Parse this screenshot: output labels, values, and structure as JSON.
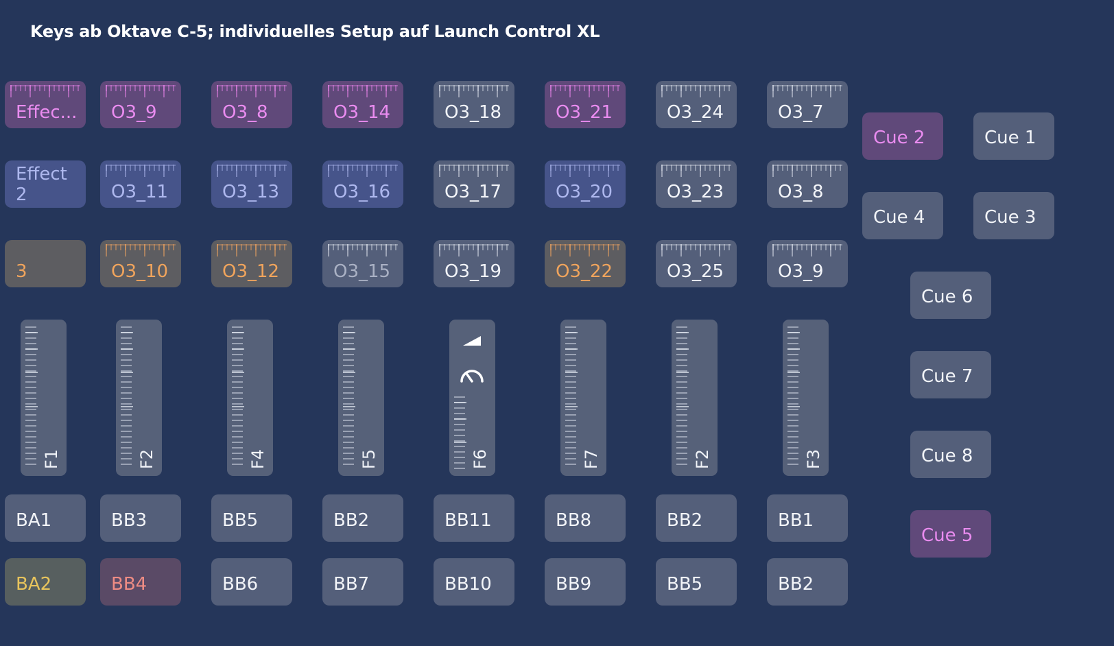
{
  "title": "Keys ab Oktave C-5; individuelles Setup auf Launch Control XL",
  "rows": {
    "row1": [
      "Effec...",
      "O3_9",
      "O3_8",
      "O3_14",
      "O3_18",
      "O3_21",
      "O3_24",
      "O3_7"
    ],
    "row2": [
      "Effect 2",
      "O3_11",
      "O3_13",
      "O3_16",
      "O3_17",
      "O3_20",
      "O3_23",
      "O3_8"
    ],
    "row3": [
      "3",
      "O3_10",
      "O3_12",
      "O3_15",
      "O3_19",
      "O3_22",
      "O3_25",
      "O3_9"
    ]
  },
  "faders": [
    "F1",
    "F2",
    "F4",
    "F5",
    "F6",
    "F7",
    "F2",
    "F3"
  ],
  "buttons": {
    "top": [
      "BA1",
      "BB3",
      "BB5",
      "BB2",
      "BB11",
      "BB8",
      "BB2",
      "BB1"
    ],
    "bottom": [
      "BA2",
      "BB4",
      "BB6",
      "BB7",
      "BB10",
      "BB9",
      "BB5",
      "BB2"
    ]
  },
  "cues": {
    "cue2": "Cue 2",
    "cue1": "Cue 1",
    "cue4": "Cue 4",
    "cue3": "Cue 3",
    "cue6": "Cue 6",
    "cue7": "Cue 7",
    "cue8": "Cue 8",
    "cue5": "Cue 5"
  },
  "icons": {
    "fader5_top": "ramp-icon",
    "fader5_mid": "gauge-icon"
  },
  "colors": {
    "background": "#25365a",
    "pink": "#ea8cf0",
    "blue": "#aeb8ee",
    "orange": "#f0a45c",
    "yellow": "#e8c45c",
    "salmon": "#ee8c84"
  }
}
